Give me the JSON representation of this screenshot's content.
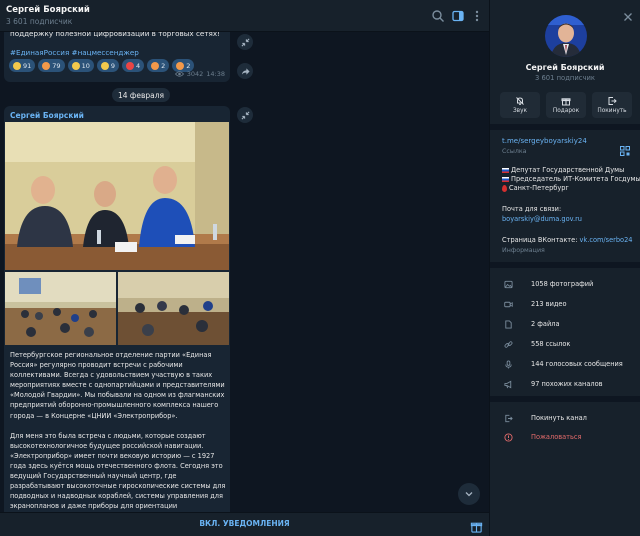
{
  "header": {
    "title": "Сергей Боярский",
    "subtitle": "3 601 подписчик"
  },
  "post1": {
    "text_tail": "поддержку полезной цифровизации в торговых сетях!",
    "hashtags": "#ЕдинаяРоссия #нацмессенджер",
    "reactions": [
      {
        "count": "91",
        "color": "#f2c94c"
      },
      {
        "count": "79",
        "color": "#f2994a"
      },
      {
        "count": "10",
        "color": "#f2c94c"
      },
      {
        "count": "9",
        "color": "#f2c94c"
      },
      {
        "count": "4",
        "color": "#e84545"
      },
      {
        "count": "2",
        "color": "#f2994a"
      },
      {
        "count": "2",
        "color": "#f2994a"
      }
    ],
    "views": "3042",
    "time": "14:38"
  },
  "date_separator": "14 февраля",
  "post2": {
    "author": "Сергей Боярский",
    "paragraphs": [
      "Петербургское региональное отделение партии «Единая Россия» регулярно проводит встречи с рабочими коллективами. Всегда с удовольствием участвую в таких мероприятиях вместе с однопартийцами и представителями «Молодой Гвардии». Мы побывали на одном из флагманских предприятий оборонно-промышленного комплекса нашего города — в Концерне «ЦНИИ «Электроприбор».",
      "Для меня это была встреча с людьми, которые создают высокотехнологичное будущее российской навигации. «Электроприбор» имеет почти вековую историю — с 1927 года здесь куётся мощь отечественного флота. Сегодня это ведущий Государственный научный центр, где разрабатывают высокоточные гироскопические системы для подводных и надводных кораблей, системы управления для экранопланов и даже приборы для ориентации искусственных спутников Земли. Продукция Центра обеспечивает безопасность страны в"
    ]
  },
  "bottom_bar": {
    "notify_label": "ВКЛ. УВЕДОМЛЕНИЯ"
  },
  "profile": {
    "name": "Сергей Боярский",
    "subscribers": "3 601 подписчик",
    "actions": [
      {
        "label": "Звук",
        "icon": "mute-icon"
      },
      {
        "label": "Подарок",
        "icon": "gift-icon"
      },
      {
        "label": "Покинуть",
        "icon": "leave-icon"
      }
    ],
    "link": "t.me/sergeyboyarskiy24",
    "link_label": "Ссылка",
    "description": [
      "Депутат Государственной Думы",
      "Председатель ИТ-Комитета Госдумы",
      "Санкт-Петербург"
    ],
    "contact_title": "Почта для связи:",
    "contact_email": "boyarskiy@duma.gov.ru",
    "vk_prefix": "Страница ВКонтакте: ",
    "vk_link": "vk.com/serbo24",
    "info_label": "Информация",
    "media": [
      {
        "label": "1058 фотографий",
        "icon": "photo-icon"
      },
      {
        "label": "213 видео",
        "icon": "video-icon"
      },
      {
        "label": "2 файла",
        "icon": "file-icon"
      },
      {
        "label": "558 ссылок",
        "icon": "link-icon"
      },
      {
        "label": "144 голосовых сообщения",
        "icon": "mic-icon"
      },
      {
        "label": "97 похожих каналов",
        "icon": "megaphone-icon"
      }
    ],
    "leave_label": "Покинуть канал",
    "report_label": "Пожаловаться"
  }
}
